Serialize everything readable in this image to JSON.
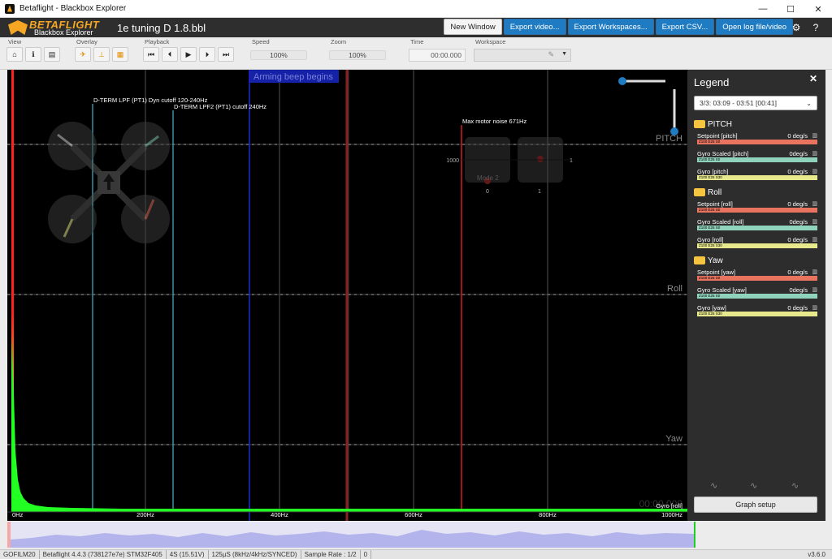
{
  "window": {
    "title": "Betaflight - Blackbox Explorer",
    "controls": [
      "—",
      "☐",
      "✕"
    ]
  },
  "header": {
    "logo_line1": "BETAFLIGHT",
    "logo_line2": "Blackbox Explorer",
    "log_file": "1e tuning D 1.8.bbl",
    "buttons": [
      "New Window",
      "Export video...",
      "Export Workspaces...",
      "Export CSV...",
      "Open log file/video"
    ],
    "settings_icon": "gear-icon",
    "help_icon": "question-icon"
  },
  "toolbar": {
    "view_label": "View",
    "overlay_label": "Overlay",
    "playback_label": "Playback",
    "speed_label": "Speed",
    "speed_value": "100%",
    "zoom_label": "Zoom",
    "zoom_value": "100%",
    "time_label": "Time",
    "time_value": "00:00.000",
    "workspace_label": "Workspace"
  },
  "graph": {
    "arming_banner": "Arming beep begins",
    "annotations": [
      "D-TERM LPF (PT1) Dyn cutoff 120-240Hz",
      "D-TERM LPF2 (PT1) cutoff 240Hz",
      "Max motor noise 671Hz"
    ],
    "axis_labels": [
      "PITCH",
      "Roll",
      "Yaw"
    ],
    "x_ticks": [
      "0Hz",
      "200Hz",
      "400Hz",
      "600Hz",
      "800Hz",
      "1000Hz"
    ],
    "stick_labels": {
      "left": "1000",
      "right": "1",
      "b0": "0",
      "b1": "1",
      "mode": "Mode 2"
    },
    "trace_label": "Gyro [roll]",
    "time_overlay": "00:00.000",
    "colors": {
      "spectrum": "#22ff22",
      "motor_line": "#d02020",
      "filter_line": "#3a8fa0"
    }
  },
  "legend": {
    "title": "Legend",
    "close": "✕",
    "time_select": "3/3: 03:09 - 03:51 [00:41]",
    "groups": [
      {
        "name": "PITCH",
        "rows": [
          {
            "name": "Setpoint [pitch]",
            "value": "0 deg/s",
            "bar": "Z100 E25 S0",
            "color": "#e8735f"
          },
          {
            "name": "Gyro Scaled [pitch]",
            "value": "0deg/s",
            "bar": "Z100 E25 S0",
            "color": "#8fd3bd"
          },
          {
            "name": "Gyro [pitch]",
            "value": "0 deg/s",
            "bar": "Z100 E25 S30",
            "color": "#e8e88d"
          }
        ]
      },
      {
        "name": "Roll",
        "rows": [
          {
            "name": "Setpoint [roll]",
            "value": "0 deg/s",
            "bar": "Z100 E25 S0",
            "color": "#e8735f"
          },
          {
            "name": "Gyro Scaled [roll]",
            "value": "0deg/s",
            "bar": "Z100 E25 S0",
            "color": "#8fd3bd"
          },
          {
            "name": "Gyro [roll]",
            "value": "0 deg/s",
            "bar": "Z100 E25 S30",
            "color": "#e8e88d"
          }
        ]
      },
      {
        "name": "Yaw",
        "rows": [
          {
            "name": "Setpoint [yaw]",
            "value": "0 deg/s",
            "bar": "Z100 E25 S0",
            "color": "#e8735f"
          },
          {
            "name": "Gyro Scaled [yaw]",
            "value": "0deg/s",
            "bar": "Z100 E25 S0",
            "color": "#8fd3bd"
          },
          {
            "name": "Gyro [yaw]",
            "value": "0 deg/s",
            "bar": "Z100 E25 S30",
            "color": "#e8e88d"
          }
        ]
      }
    ],
    "graph_setup": "Graph setup"
  },
  "status": [
    "GOFILM20",
    "Betaflight 4.4.3 (738127e7e) STM32F405",
    "4S (15.51V)",
    "125µS (8kHz/4kHz/SYNCED)",
    "Sample Rate : 1/2",
    "0"
  ],
  "version": "v3.6.0"
}
